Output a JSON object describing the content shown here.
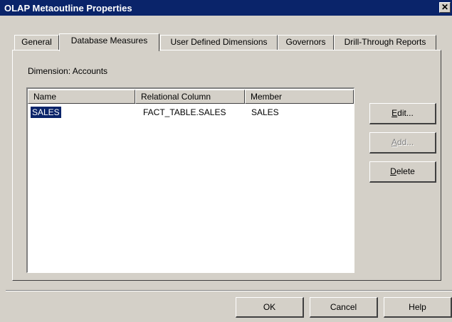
{
  "window": {
    "title": "OLAP Metaoutline Properties",
    "close_glyph": "✕"
  },
  "tabs": [
    {
      "label": "General",
      "active": false
    },
    {
      "label": "Database Measures",
      "active": true
    },
    {
      "label": "User Defined Dimensions",
      "active": false
    },
    {
      "label": "Governors",
      "active": false
    },
    {
      "label": "Drill-Through Reports",
      "active": false
    }
  ],
  "dimension_label": "Dimension: Accounts",
  "table": {
    "columns": [
      "Name",
      "Relational Column",
      "Member"
    ],
    "rows": [
      {
        "name": "SALES",
        "relational_column": "FACT_TABLE.SALES",
        "member": "SALES",
        "selected": true
      }
    ]
  },
  "side_buttons": {
    "edit": {
      "mnemonic": "E",
      "rest": "dit...",
      "enabled": true
    },
    "add": {
      "mnemonic": "A",
      "rest": "dd...",
      "enabled": false
    },
    "delete": {
      "mnemonic": "D",
      "rest": "elete",
      "enabled": true
    }
  },
  "footer_buttons": {
    "ok": "OK",
    "cancel": "Cancel",
    "help": "Help"
  },
  "colors": {
    "title_bar": "#0a246a",
    "dialog_face": "#d4d0c8",
    "selection": "#0a246a"
  }
}
